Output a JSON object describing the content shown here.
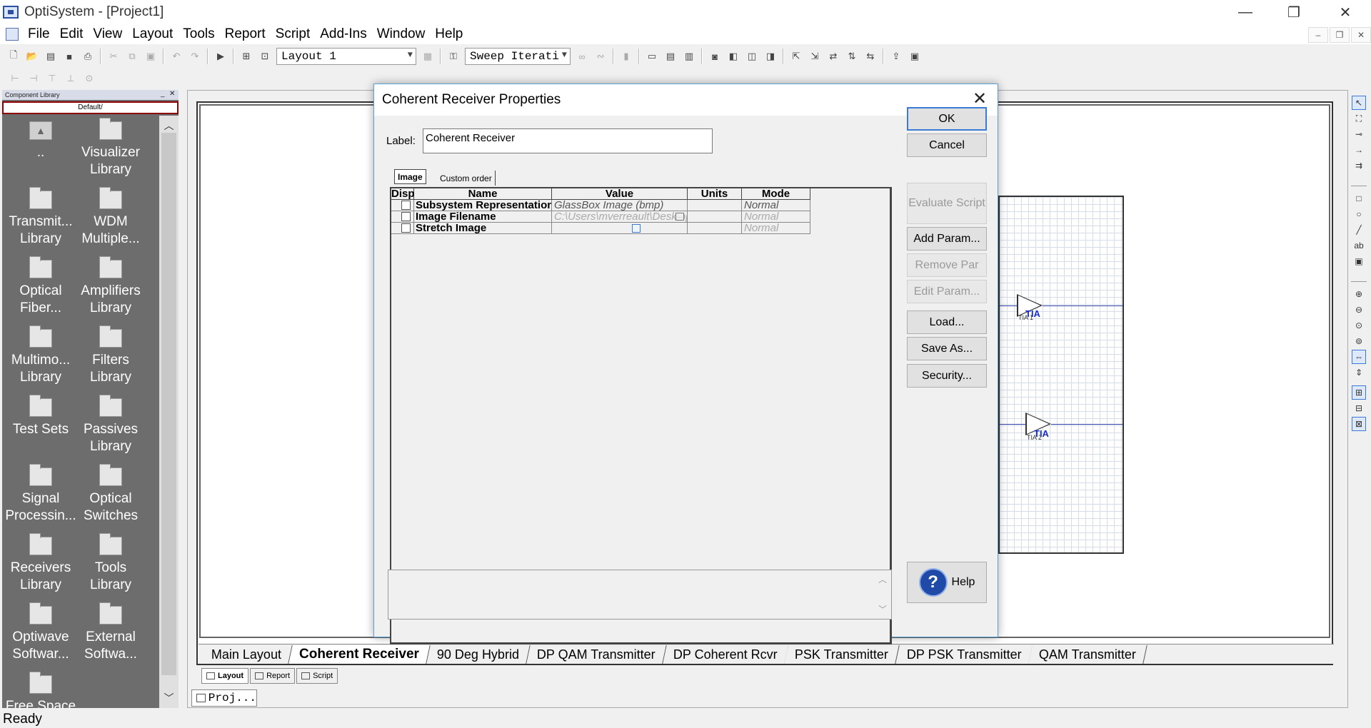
{
  "window": {
    "title": "OptiSystem - [Project1]",
    "controls": {
      "minimize": "—",
      "restore": "❐",
      "close": "✕"
    }
  },
  "menu": [
    "File",
    "Edit",
    "View",
    "Layout",
    "Tools",
    "Report",
    "Script",
    "Add-Ins",
    "Window",
    "Help"
  ],
  "toolbar": {
    "layout_combo": "Layout 1",
    "sweep_combo": "Sweep Iterati"
  },
  "library": {
    "header": "Component Library",
    "path": "Default/",
    "items": [
      {
        "label": "..",
        "kind": "up"
      },
      {
        "label": "Visualizer\nLibrary",
        "kind": "folder"
      },
      {
        "label": "Transmit...\nLibrary",
        "kind": "folder"
      },
      {
        "label": "WDM\nMultiple...",
        "kind": "folder"
      },
      {
        "label": "Optical\nFiber...",
        "kind": "folder"
      },
      {
        "label": "Amplifiers\nLibrary",
        "kind": "folder"
      },
      {
        "label": "Multimo...\nLibrary",
        "kind": "folder"
      },
      {
        "label": "Filters\nLibrary",
        "kind": "folder"
      },
      {
        "label": "Test Sets",
        "kind": "folder"
      },
      {
        "label": "Passives\nLibrary",
        "kind": "folder"
      },
      {
        "label": "Signal\nProcessin...",
        "kind": "folder"
      },
      {
        "label": "Optical\nSwitches",
        "kind": "folder"
      },
      {
        "label": "Receivers\nLibrary",
        "kind": "folder"
      },
      {
        "label": "Tools\nLibrary",
        "kind": "folder"
      },
      {
        "label": "Optiwave\nSoftwar...",
        "kind": "folder"
      },
      {
        "label": "External\nSoftwa...",
        "kind": "folder"
      },
      {
        "label": "Free Space",
        "kind": "folder"
      }
    ]
  },
  "canvas": {
    "components": [
      {
        "label": "TIA",
        "sub": "TIA 1"
      },
      {
        "label": "TIA",
        "sub": "TIA 2"
      }
    ]
  },
  "layout_tabs": {
    "items": [
      "Main Layout",
      "Coherent Receiver",
      "90 Deg Hybrid",
      "DP QAM Transmitter",
      "DP Coherent Rcvr",
      "PSK Transmitter",
      "DP PSK Transmitter",
      "QAM Transmitter"
    ],
    "active_index": 1
  },
  "view_tabs": [
    "Layout",
    "Report",
    "Script"
  ],
  "project_tab": "Proj...",
  "status": "Ready",
  "dialog": {
    "title": "Coherent Receiver Properties",
    "label_caption": "Label:",
    "label_value": "Coherent Receiver",
    "tabs": [
      "Image",
      "Custom order"
    ],
    "columns": [
      "Disp",
      "Name",
      "Value",
      "Units",
      "Mode"
    ],
    "rows": [
      {
        "name": "Subsystem Representation",
        "value": "GlassBox Image (bmp)",
        "units": "",
        "mode": "Normal"
      },
      {
        "name": "Image Filename",
        "value": "C:\\Users\\mverreault\\Desktop\\",
        "units": "",
        "mode": "Normal"
      },
      {
        "name": "Stretch Image",
        "value": "",
        "units": "",
        "mode": "Normal"
      }
    ],
    "buttons": {
      "ok": "OK",
      "cancel": "Cancel",
      "evaluate_script": "Evaluate Script",
      "add_param": "Add Param...",
      "remove_par": "Remove Par",
      "edit_param": "Edit Param...",
      "load": "Load...",
      "save_as": "Save As...",
      "security": "Security...",
      "help": "Help"
    },
    "close_glyph": "✕"
  },
  "colors": {
    "library_bg": "#6d6d6d",
    "dialog_border": "#5a9fd4",
    "component_label": "#1a2fc8",
    "link_line": "#2f3fa8"
  }
}
